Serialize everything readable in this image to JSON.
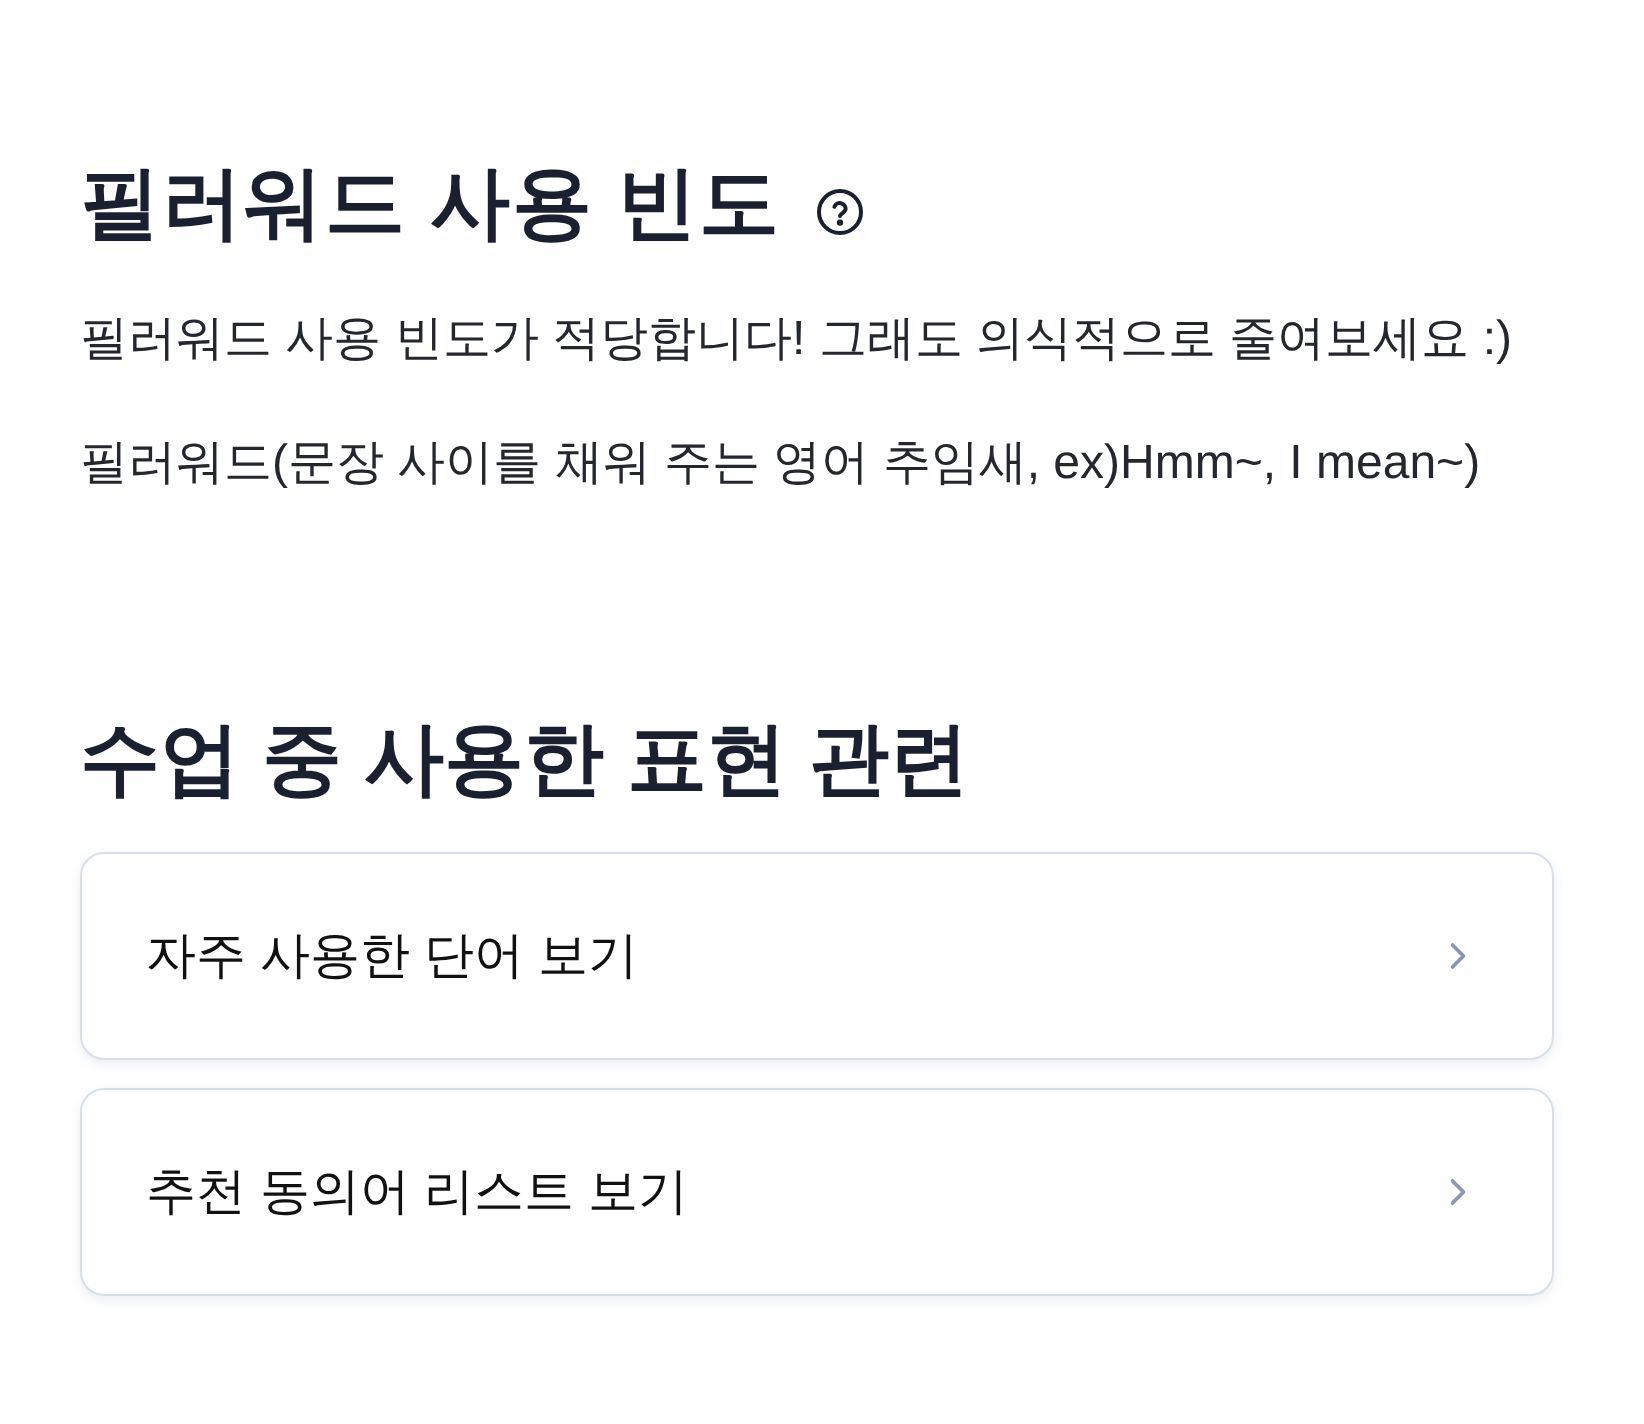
{
  "filler_words": {
    "title": "필러워드 사용 빈도",
    "descriptions": [
      "필러워드 사용 빈도가 적당합니다! 그래도 의식적으로 줄여보세요 :)",
      "필러워드(문장 사이를 채워 주는 영어 추임새, ex)Hmm~, I mean~)"
    ]
  },
  "expressions": {
    "title": "수업 중 사용한 표현 관련",
    "links": [
      {
        "label": "자주 사용한 단어 보기"
      },
      {
        "label": "추천 동의어 리스트 보기"
      }
    ]
  }
}
